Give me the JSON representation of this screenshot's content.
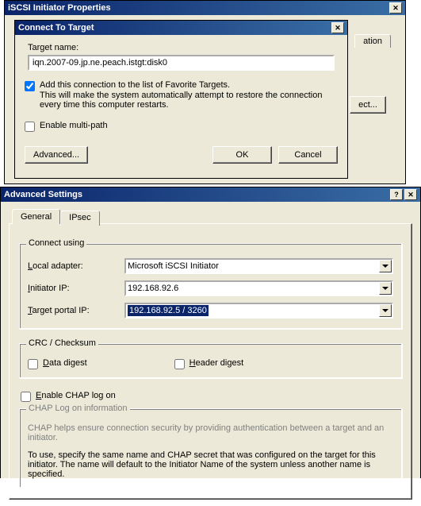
{
  "win1": {
    "title": "iSCSI Initiator Properties",
    "frag_tab": "ation",
    "frag_btn": "ect..."
  },
  "win2": {
    "title": "Connect To Target",
    "target_name_label": "Target name:",
    "target_name_value": "iqn.2007-09.jp.ne.peach.istgt:disk0",
    "fav_label": "Add this connection to the list of Favorite Targets.",
    "fav_help": "This will make the system automatically attempt to restore the connection every time this computer restarts.",
    "multipath_label": "Enable multi-path",
    "advanced_btn": "Advanced...",
    "ok_btn": "OK",
    "cancel_btn": "Cancel"
  },
  "win3": {
    "title": "Advanced Settings",
    "tab_general": "General",
    "tab_ipsec": "IPsec",
    "grp_connect": "Connect using",
    "local_adapter_label": "Local adapter:",
    "local_adapter_value": "Microsoft iSCSI Initiator",
    "initiator_ip_label": "Initiator IP:",
    "initiator_ip_value": "192.168.92.6",
    "target_portal_label": "Target portal IP:",
    "target_portal_value": "192.168.92.5 / 3260",
    "grp_crc": "CRC / Checksum",
    "data_digest": "Data digest",
    "header_digest": "Header digest",
    "enable_chap": "Enable CHAP log on",
    "grp_chap": "CHAP Log on information",
    "chap_help1": "CHAP helps ensure connection security by providing authentication between a target and an initiator.",
    "chap_help2": "To use, specify the same name and CHAP secret that was configured on the target for this initiator.  The name will default to the Initiator Name of the system unless another name is specified."
  }
}
